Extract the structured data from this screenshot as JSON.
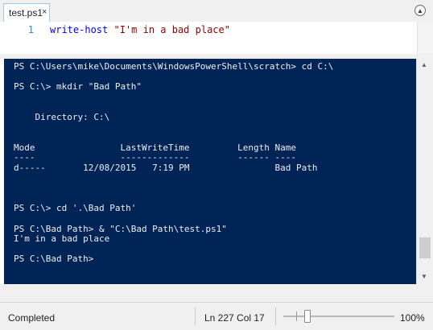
{
  "tab": {
    "label": "test.ps1",
    "close_glyph": "×"
  },
  "collapse_glyph": "▲",
  "editor": {
    "line_number": "1",
    "code_command": "write-host",
    "code_string": "\"I'm in a bad place\""
  },
  "console": {
    "background_color": "#012456",
    "text_color": "#eeedf0",
    "output": "PS C:\\Users\\mike\\Documents\\WindowsPowerShell\\scratch> cd C:\\\n\nPS C:\\> mkdir \"Bad Path\"\n\n\n    Directory: C:\\\n\n\nMode                LastWriteTime         Length Name\n----                -------------         ------ ----\nd-----       12/08/2015   7:19 PM                Bad Path\n\n\n\nPS C:\\> cd '.\\Bad Path'\n\nPS C:\\Bad Path> & \"C:\\Bad Path\\test.ps1\"\nI'm in a bad place\n\nPS C:\\Bad Path>",
    "scroll_up_glyph": "▲",
    "scroll_down_glyph": "▼"
  },
  "status": {
    "state": "Completed",
    "cursor": "Ln 227  Col 17",
    "zoom": "100%"
  },
  "colors": {
    "keyword": "#0000ff",
    "string": "#8b0000",
    "line_number": "#2b91af"
  }
}
